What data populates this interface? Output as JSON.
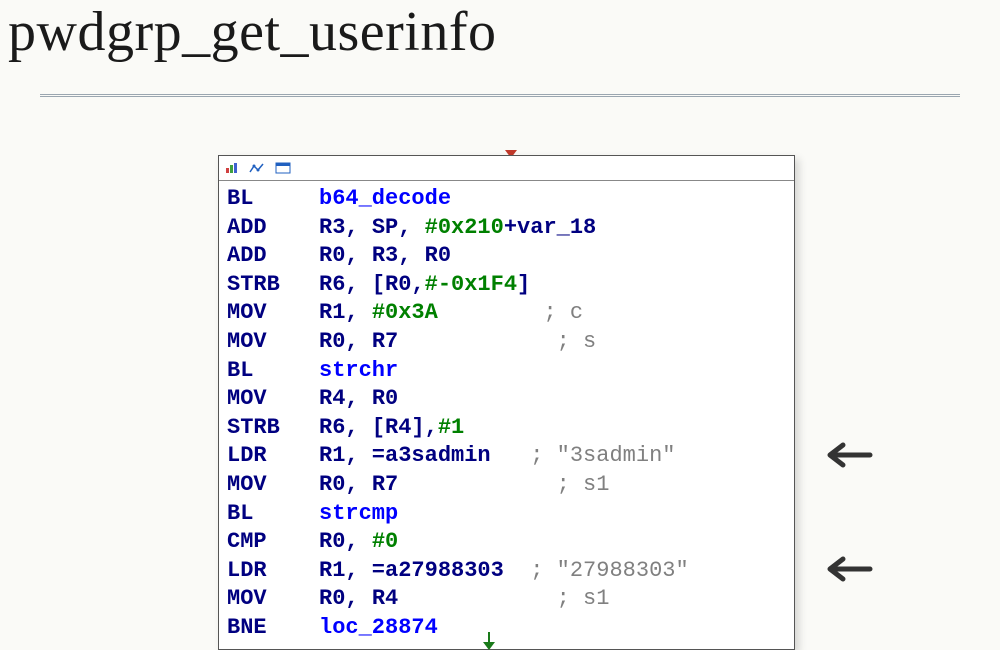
{
  "title": "pwdgrp_get_userinfo",
  "icons": [
    "bar-chart-icon",
    "graph-icon",
    "window-icon"
  ],
  "code": [
    {
      "mnemonic": "BL",
      "ops": [
        {
          "t": "sym",
          "v": "b64_decode"
        }
      ]
    },
    {
      "mnemonic": "ADD",
      "ops": [
        {
          "t": "reg",
          "v": "R3"
        },
        {
          "t": "p",
          "v": ", "
        },
        {
          "t": "reg",
          "v": "SP"
        },
        {
          "t": "p",
          "v": ", "
        },
        {
          "t": "imm",
          "v": "#0x210"
        },
        {
          "t": "reg",
          "v": "+var_18"
        }
      ]
    },
    {
      "mnemonic": "ADD",
      "ops": [
        {
          "t": "reg",
          "v": "R0"
        },
        {
          "t": "p",
          "v": ", "
        },
        {
          "t": "reg",
          "v": "R3"
        },
        {
          "t": "p",
          "v": ", "
        },
        {
          "t": "reg",
          "v": "R0"
        }
      ]
    },
    {
      "mnemonic": "STRB",
      "ops": [
        {
          "t": "reg",
          "v": "R6"
        },
        {
          "t": "p",
          "v": ", ["
        },
        {
          "t": "reg",
          "v": "R0"
        },
        {
          "t": "p",
          "v": ","
        },
        {
          "t": "imm",
          "v": "#-0x1F4"
        },
        {
          "t": "p",
          "v": "]"
        }
      ]
    },
    {
      "mnemonic": "MOV",
      "ops": [
        {
          "t": "reg",
          "v": "R1"
        },
        {
          "t": "p",
          "v": ", "
        },
        {
          "t": "imm",
          "v": "#0x3A"
        }
      ],
      "pad": 8,
      "comment": "; c"
    },
    {
      "mnemonic": "MOV",
      "ops": [
        {
          "t": "reg",
          "v": "R0"
        },
        {
          "t": "p",
          "v": ", "
        },
        {
          "t": "reg",
          "v": "R7"
        }
      ],
      "pad": 12,
      "comment": "; s"
    },
    {
      "mnemonic": "BL",
      "ops": [
        {
          "t": "sym",
          "v": "strchr"
        }
      ]
    },
    {
      "mnemonic": "MOV",
      "ops": [
        {
          "t": "reg",
          "v": "R4"
        },
        {
          "t": "p",
          "v": ", "
        },
        {
          "t": "reg",
          "v": "R0"
        }
      ]
    },
    {
      "mnemonic": "STRB",
      "ops": [
        {
          "t": "reg",
          "v": "R6"
        },
        {
          "t": "p",
          "v": ", ["
        },
        {
          "t": "reg",
          "v": "R4"
        },
        {
          "t": "p",
          "v": "],"
        },
        {
          "t": "imm",
          "v": "#1"
        }
      ]
    },
    {
      "mnemonic": "LDR",
      "ops": [
        {
          "t": "reg",
          "v": "R1"
        },
        {
          "t": "p",
          "v": ", ="
        },
        {
          "t": "reg",
          "v": "a3sadmin"
        }
      ],
      "pad": 3,
      "comment": "; \"3sadmin\""
    },
    {
      "mnemonic": "MOV",
      "ops": [
        {
          "t": "reg",
          "v": "R0"
        },
        {
          "t": "p",
          "v": ", "
        },
        {
          "t": "reg",
          "v": "R7"
        }
      ],
      "pad": 12,
      "comment": "; s1"
    },
    {
      "mnemonic": "BL",
      "ops": [
        {
          "t": "sym",
          "v": "strcmp"
        }
      ]
    },
    {
      "mnemonic": "CMP",
      "ops": [
        {
          "t": "reg",
          "v": "R0"
        },
        {
          "t": "p",
          "v": ", "
        },
        {
          "t": "imm",
          "v": "#0"
        }
      ]
    },
    {
      "mnemonic": "LDR",
      "ops": [
        {
          "t": "reg",
          "v": "R1"
        },
        {
          "t": "p",
          "v": ", ="
        },
        {
          "t": "reg",
          "v": "a27988303"
        }
      ],
      "pad": 2,
      "comment": "; \"27988303\""
    },
    {
      "mnemonic": "MOV",
      "ops": [
        {
          "t": "reg",
          "v": "R0"
        },
        {
          "t": "p",
          "v": ", "
        },
        {
          "t": "reg",
          "v": "R4"
        }
      ],
      "pad": 12,
      "comment": "; s1"
    },
    {
      "mnemonic": "BNE",
      "ops": [
        {
          "t": "sym",
          "v": "loc_28874"
        }
      ]
    }
  ],
  "arrows": [
    {
      "target_line": 9
    },
    {
      "target_line": 13
    }
  ]
}
